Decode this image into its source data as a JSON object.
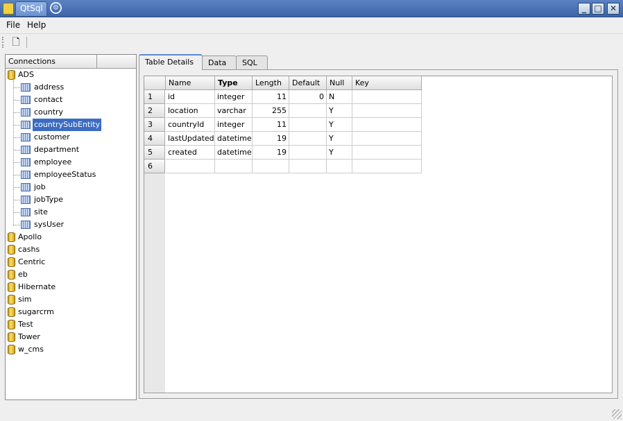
{
  "window": {
    "title": "QtSql"
  },
  "menubar": {
    "file": "File",
    "help": "Help"
  },
  "connections": {
    "header": "Connections",
    "databases": [
      "ADS",
      "Apollo",
      "cashs",
      "Centric",
      "eb",
      "Hibernate",
      "sim",
      "sugarcrm",
      "Test",
      "Tower",
      "w_cms"
    ],
    "expanded_tables": [
      "address",
      "contact",
      "country",
      "countrySubEntity",
      "customer",
      "department",
      "employee",
      "employeeStatus",
      "job",
      "jobType",
      "site",
      "sysUser"
    ],
    "selected_table": "countrySubEntity"
  },
  "tabs": [
    "Table Details",
    "Data",
    "SQL"
  ],
  "active_tab": "Table Details",
  "table_details": {
    "columns": [
      "Name",
      "Type",
      "Length",
      "Default",
      "Null",
      "Key"
    ],
    "row_numbers": [
      "1",
      "2",
      "3",
      "4",
      "5",
      "6"
    ],
    "rows": [
      [
        "id",
        "integer",
        "11",
        "0",
        "N",
        ""
      ],
      [
        "location",
        "varchar",
        "255",
        "",
        "Y",
        ""
      ],
      [
        "countryId",
        "integer",
        "11",
        "",
        "Y",
        ""
      ],
      [
        "lastUpdated",
        "datetime",
        "19",
        "",
        "Y",
        ""
      ],
      [
        "created",
        "datetime",
        "19",
        "",
        "Y",
        ""
      ],
      [
        "",
        "",
        "",
        "",
        "",
        ""
      ]
    ]
  }
}
